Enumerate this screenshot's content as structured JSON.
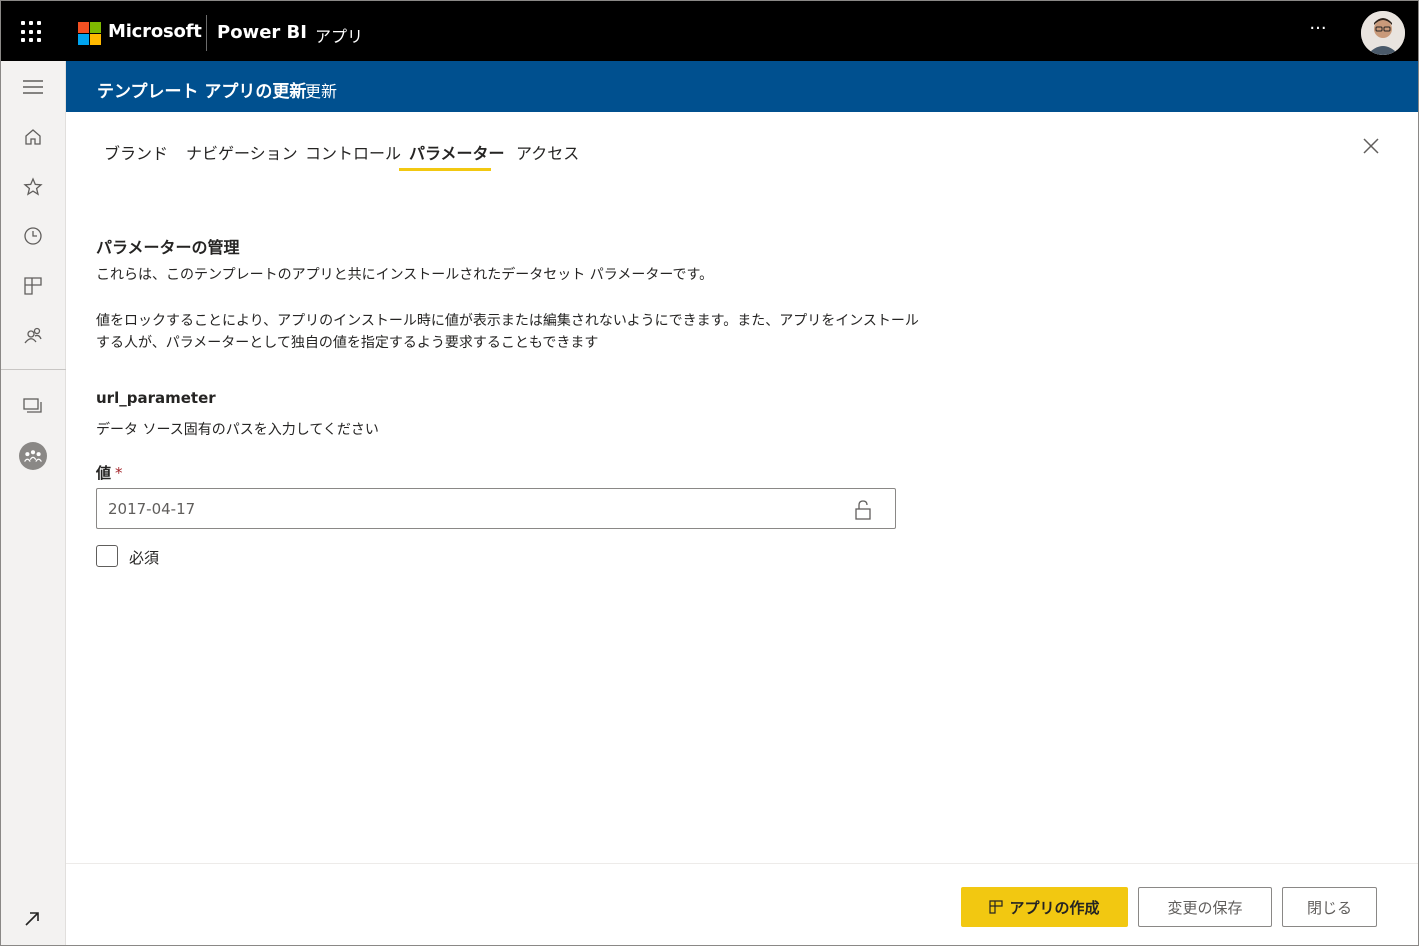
{
  "topbar": {
    "brand": "Microsoft",
    "product": "Power BI",
    "section": "アプリ",
    "more_label": "···",
    "icons": {
      "launcher": "app-launcher-icon",
      "more": "more-options-icon",
      "avatar": "user-avatar"
    }
  },
  "leftnav": {
    "items": [
      {
        "name": "menu-icon"
      },
      {
        "name": "home-icon"
      },
      {
        "name": "favorites-star-icon"
      },
      {
        "name": "recent-clock-icon"
      },
      {
        "name": "apps-icon"
      },
      {
        "name": "shared-with-me-icon"
      },
      {
        "name": "workspaces-icon"
      },
      {
        "name": "workspace-avatar-icon"
      },
      {
        "name": "expand-arrow-icon"
      }
    ]
  },
  "header": {
    "title": "テンプレート アプリの更新",
    "subtitle": "更新"
  },
  "tabs": [
    {
      "label": "ブランド",
      "active": false
    },
    {
      "label": "ナビゲーション",
      "active": false
    },
    {
      "label": "コントロール",
      "active": false
    },
    {
      "label": "パラメーター",
      "active": true
    },
    {
      "label": "アクセス",
      "active": false
    }
  ],
  "content": {
    "section_title": "パラメーターの管理",
    "intro": "これらは、このテンプレートのアプリと共にインストールされたデータセット パラメーターです。",
    "lock_line1": "値をロックすることにより、アプリのインストール時に値が表示または編集されないようにできます。また、アプリをインストール",
    "lock_line2": "する人が、パラメーターとして独自の値を指定するよう要求することもできます",
    "parameter": {
      "name": "url_parameter",
      "description": "データ ソース固有のパスを入力してください",
      "value_label": "値",
      "required_marker": "*",
      "value": "2017-04-17",
      "required_checkbox_label": "必須",
      "required_checked": false
    }
  },
  "footer": {
    "create_app": "アプリの作成",
    "save_changes": "変更の保存",
    "close": "閉じる"
  },
  "colors": {
    "topbar": "#000000",
    "header": "#00508f",
    "accent": "#f2c811",
    "required": "#a4262c"
  }
}
